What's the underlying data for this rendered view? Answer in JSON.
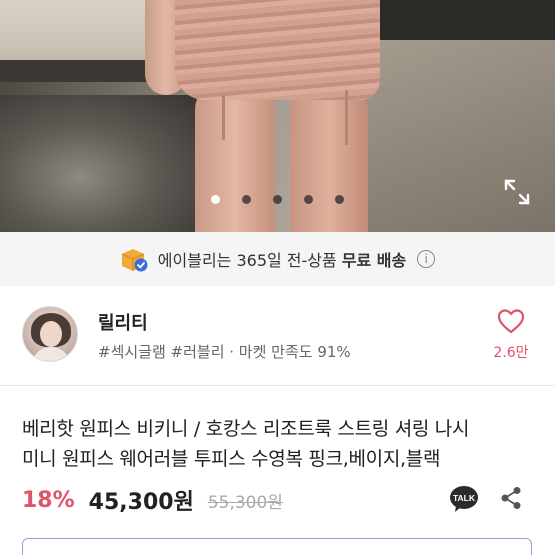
{
  "gallery": {
    "image_alt": "pink shirring mini skirt product photo",
    "dot_count": 5,
    "active_index": 0,
    "expand_icon": "expand-icon"
  },
  "shipping": {
    "prefix": "에이블리는 365일 전-상품",
    "highlight": "무료 배송",
    "box_icon": "box-check-icon",
    "info_icon": "info-icon"
  },
  "seller": {
    "name": "릴리티",
    "tags": "#섹시글램 #러블리 · 마켓 만족도 91%",
    "likes": "2.6만",
    "heart_icon": "heart-icon"
  },
  "product": {
    "title_line1": "베리핫 원피스 비키니 / 호캉스 리조트룩 스트링 셔링 나시",
    "title_line2": "미니 원피스 웨어러블 투피스 수영복 핑크,베이지,블랙",
    "discount": "18%",
    "price": "45,300원",
    "original_price": "55,300원",
    "talk_label": "TALK"
  },
  "colors": {
    "accent": "#e0536a",
    "banner_bg": "#f5f5f5"
  }
}
